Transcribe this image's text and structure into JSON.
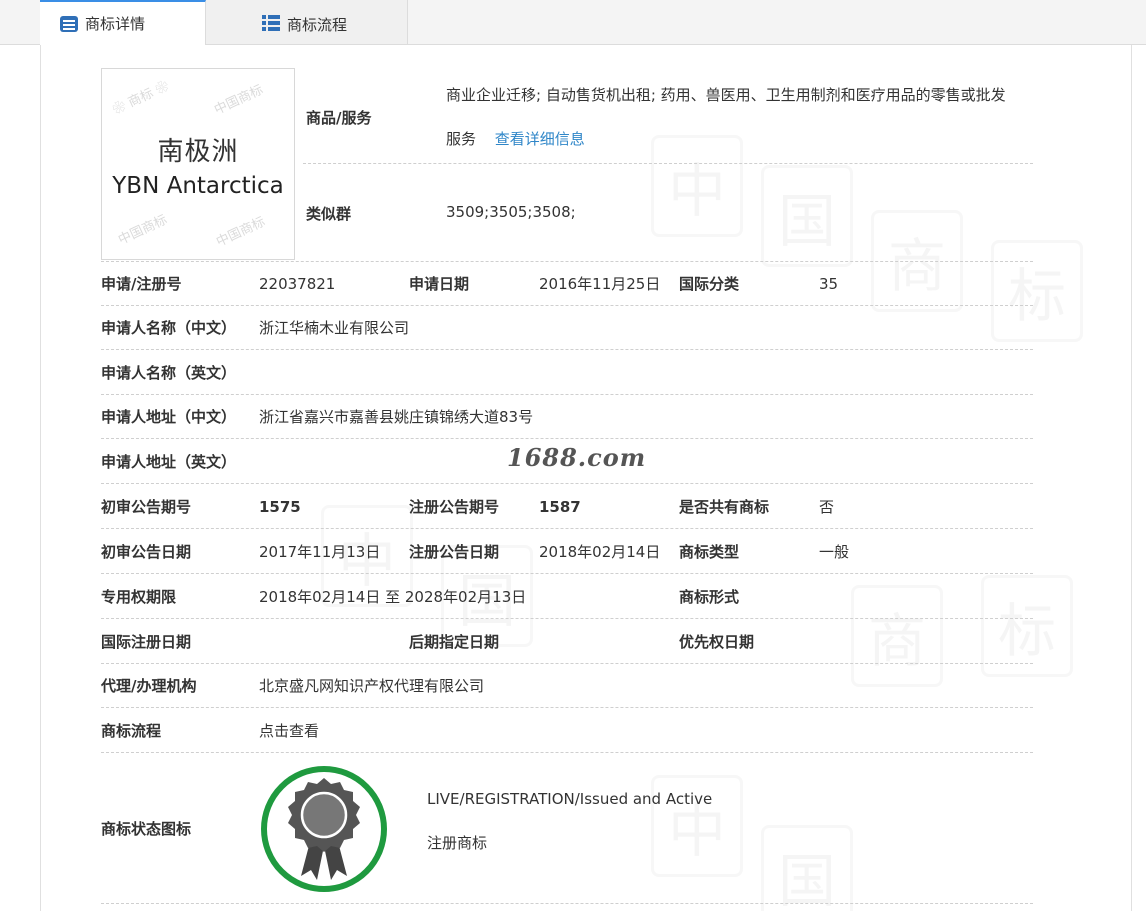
{
  "tabs": [
    {
      "label": "商标详情",
      "icon": "doc-icon",
      "active": true
    },
    {
      "label": "商标流程",
      "icon": "list-icon",
      "active": false
    }
  ],
  "logo": {
    "cn": "南极洲",
    "en": "YBN Antarctica"
  },
  "goods": {
    "label": "商品/服务",
    "line1": "商业企业迁移; 自动售货机出租; 药用、兽医用、卫生用制剂和医疗用品的零售或批发",
    "line2": "服务",
    "link": "查看详细信息"
  },
  "similar": {
    "label": "类似群",
    "value": "3509;3505;3508;"
  },
  "fields": {
    "reg_no": {
      "label": "申请/注册号",
      "value": "22037821"
    },
    "apply_date": {
      "label": "申请日期",
      "value": "2016年11月25日"
    },
    "intl_class": {
      "label": "国际分类",
      "value": "35"
    },
    "applicant_cn": {
      "label": "申请人名称（中文）",
      "value": "浙江华楠木业有限公司"
    },
    "applicant_en": {
      "label": "申请人名称（英文）",
      "value": ""
    },
    "address_cn": {
      "label": "申请人地址（中文）",
      "value": "浙江省嘉兴市嘉善县姚庄镇锦绣大道83号"
    },
    "address_en": {
      "label": "申请人地址（英文）",
      "value": ""
    },
    "prelim_no": {
      "label": "初审公告期号",
      "value": "1575"
    },
    "reg_pub_no": {
      "label": "注册公告期号",
      "value": "1587"
    },
    "shared": {
      "label": "是否共有商标",
      "value": "否"
    },
    "prelim_date": {
      "label": "初审公告日期",
      "value": "2017年11月13日"
    },
    "reg_pub_date": {
      "label": "注册公告日期",
      "value": "2018年02月14日"
    },
    "mark_type": {
      "label": "商标类型",
      "value": "一般"
    },
    "term": {
      "label": "专用权期限",
      "value": "2018年02月14日 至 2028年02月13日"
    },
    "mark_form": {
      "label": "商标形式",
      "value": ""
    },
    "intl_reg_date": {
      "label": "国际注册日期",
      "value": ""
    },
    "later_date": {
      "label": "后期指定日期",
      "value": ""
    },
    "priority_date": {
      "label": "优先权日期",
      "value": ""
    },
    "agent": {
      "label": "代理/办理机构",
      "value": "北京盛凡网知识产权代理有限公司"
    },
    "process": {
      "label": "商标流程",
      "link": "点击查看"
    }
  },
  "status": {
    "label": "商标状态图标",
    "en": "LIVE/REGISTRATION/Issued and Active",
    "cn": "注册商标"
  },
  "site_watermark": "1688.com",
  "colors": {
    "accent": "#2f86c8",
    "badge_green": "#1f9a3f"
  }
}
